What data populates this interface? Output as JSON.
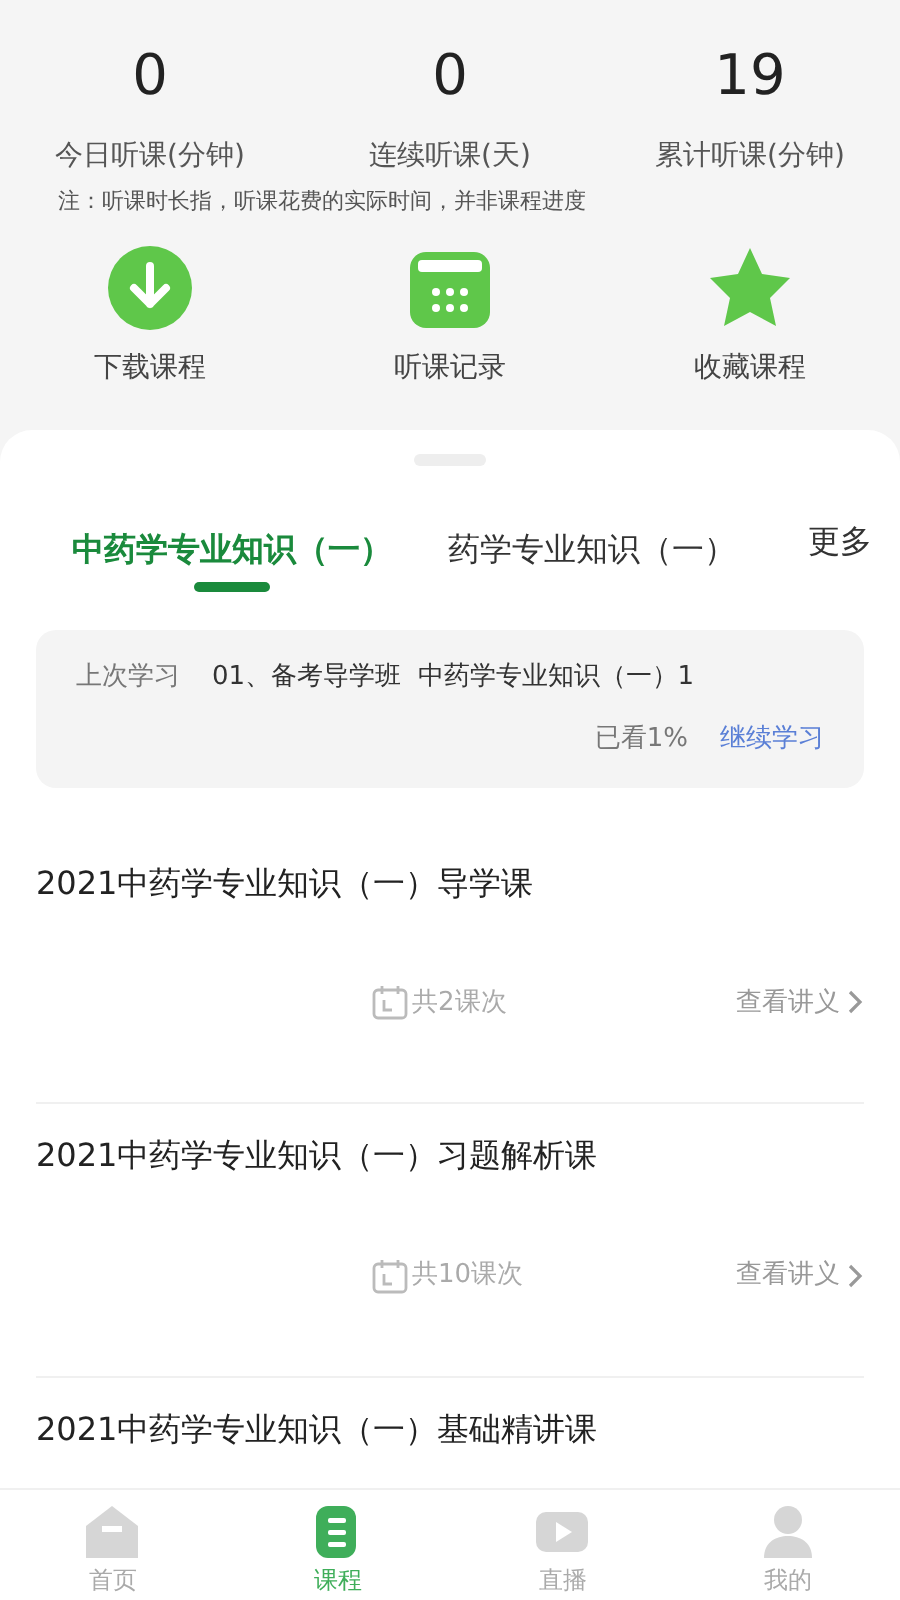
{
  "stats": [
    {
      "value": "0",
      "label": "今日听课(分钟)"
    },
    {
      "value": "0",
      "label": "连续听课(天)"
    },
    {
      "value": "19",
      "label": "累计听课(分钟)"
    }
  ],
  "note": "注：听课时长指，听课花费的实际时间，并非课程进度",
  "shortcuts": [
    {
      "kind": "download",
      "label": "下载课程"
    },
    {
      "kind": "calendar",
      "label": "听课记录"
    },
    {
      "kind": "star",
      "label": "收藏课程"
    }
  ],
  "tabs": [
    {
      "label": "中药学专业知识（一）",
      "selected": true
    },
    {
      "label": "药学专业知识（一）",
      "selected": false
    }
  ],
  "more": "更多",
  "last_study": {
    "label": "上次学习",
    "course": "01、备考导学班  中药学专业知识（一）1",
    "progress": "已看1%",
    "action": "继续学习"
  },
  "courses": [
    {
      "title": "2021中药学专业知识（一）导学课",
      "count": "共2课次",
      "notes": "查看讲义"
    },
    {
      "title": "2021中药学专业知识（一）习题解析课",
      "count": "共10课次",
      "notes": "查看讲义"
    },
    {
      "title": "2021中药学专业知识（一）基础精讲课"
    }
  ],
  "nav": [
    {
      "kind": "home",
      "label": "首页",
      "selected": false
    },
    {
      "kind": "course",
      "label": "课程",
      "selected": true
    },
    {
      "kind": "live",
      "label": "直播",
      "selected": false
    },
    {
      "kind": "me",
      "label": "我的",
      "selected": false
    }
  ]
}
